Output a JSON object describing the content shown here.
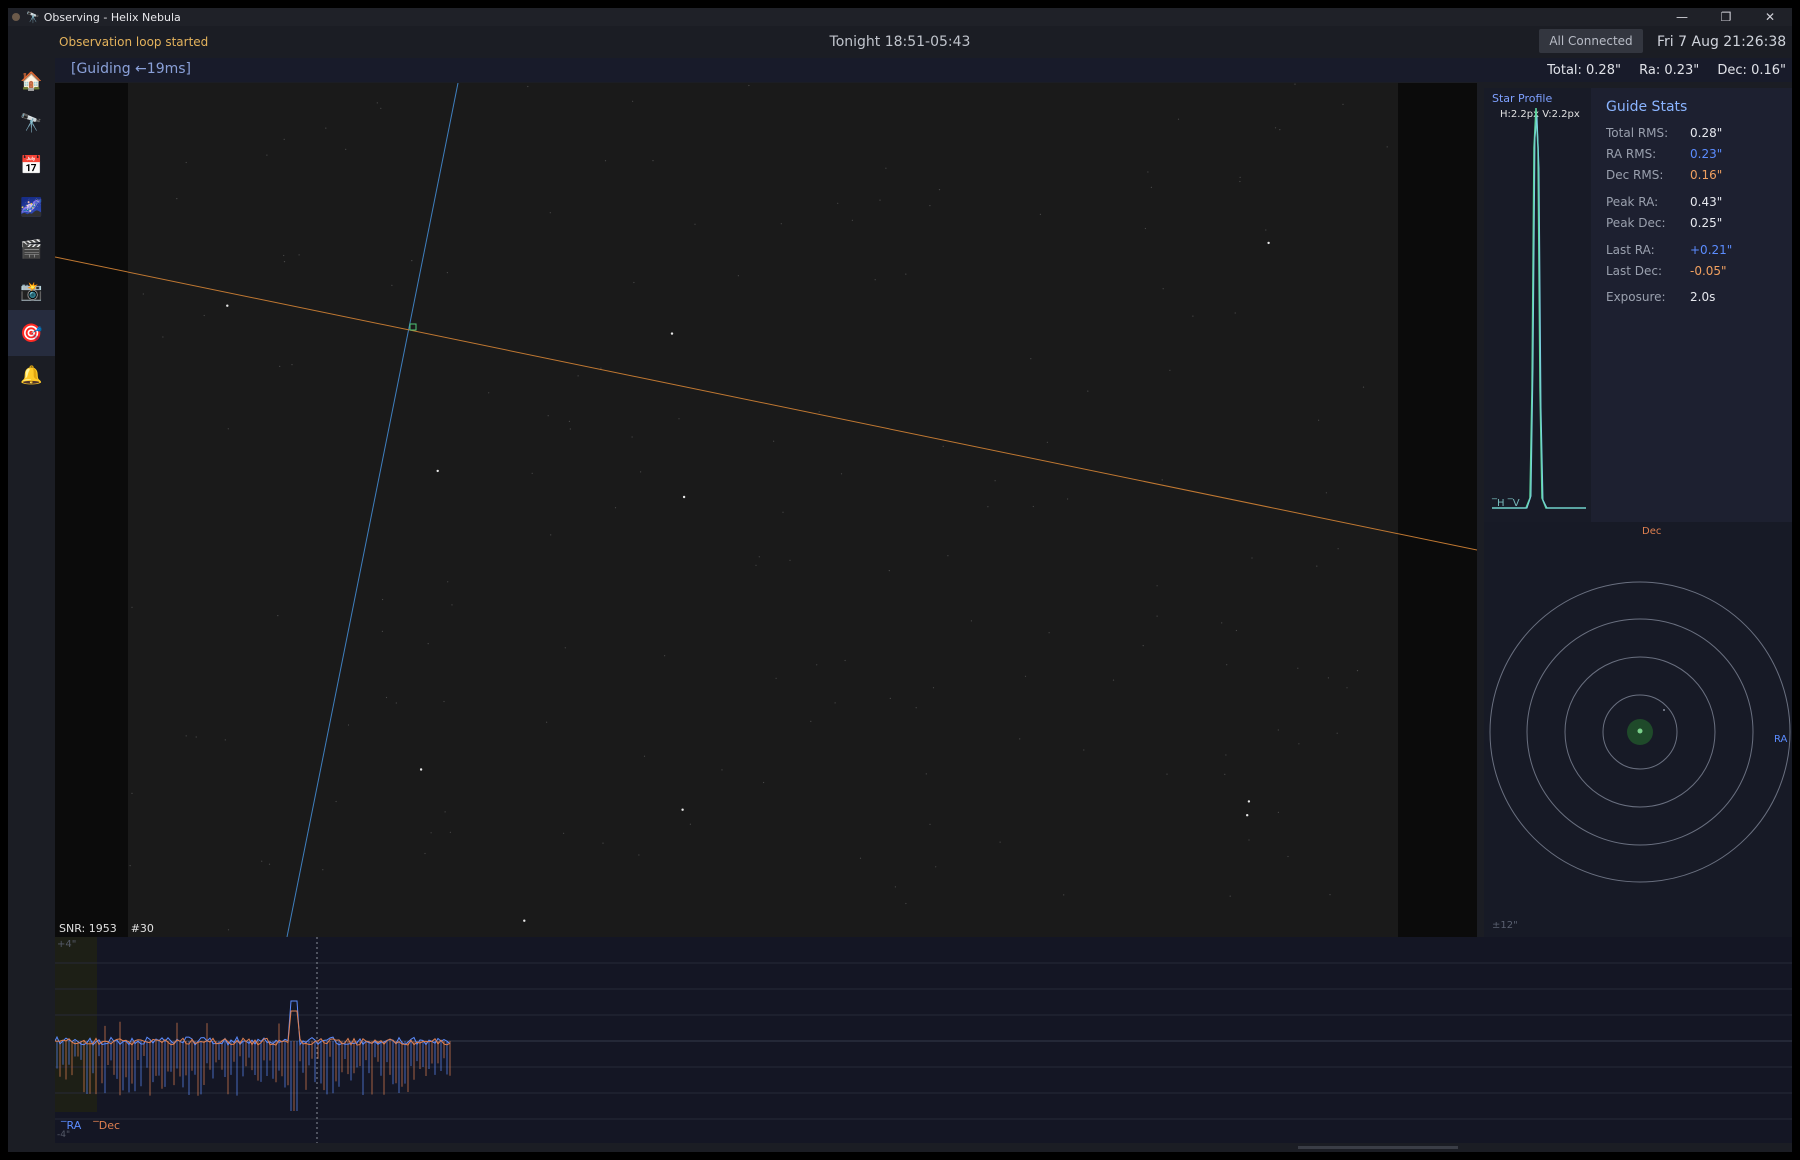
{
  "window": {
    "title": "Observing - Helix Nebula",
    "controls": {
      "minimize": "—",
      "maximize": "❐",
      "close": "✕"
    }
  },
  "status": {
    "message": "Observation loop started",
    "tonight": "Tonight  18:51-05:43",
    "connection": "All Connected",
    "datetime": "Fri 7 Aug 21:26:38"
  },
  "sidebar": {
    "items": [
      {
        "name": "home",
        "icon": "🏠"
      },
      {
        "name": "telescope",
        "icon": "🔭"
      },
      {
        "name": "calendar",
        "icon": "📅"
      },
      {
        "name": "galaxy",
        "icon": "🌌"
      },
      {
        "name": "sequence",
        "icon": "🎬"
      },
      {
        "name": "camera",
        "icon": "📸"
      },
      {
        "name": "guiding",
        "icon": "🎯",
        "active": true
      },
      {
        "name": "alerts",
        "icon": "🔔"
      }
    ]
  },
  "guiding": {
    "label": "[Guiding ←19ms]",
    "total": "Total: 0.28\"",
    "ra": "Ra: 0.23\"",
    "dec": "Dec: 0.16\""
  },
  "camera": {
    "snr": "SNR: 1953",
    "frame": "#30"
  },
  "profile": {
    "title": "Star Profile",
    "sizes": "H:2.2px  V:2.2px",
    "legend": "‾H ‾V"
  },
  "stats": {
    "title": "Guide Stats",
    "rows": [
      {
        "label": "Total RMS:",
        "value": "0.28\"",
        "color": "#e6e8ee"
      },
      {
        "label": "RA RMS:",
        "value": "0.23\"",
        "color": "#5b8cff"
      },
      {
        "label": "Dec RMS:",
        "value": "0.16\"",
        "color": "#f0a060"
      },
      {
        "label": "Peak RA:",
        "value": "0.43\"",
        "color": "#e6e8ee"
      },
      {
        "label": "Peak Dec:",
        "value": "0.25\"",
        "color": "#e6e8ee"
      },
      {
        "label": "Last RA:",
        "value": "+0.21\"",
        "color": "#5b8cff"
      },
      {
        "label": "Last Dec:",
        "value": "-0.05\"",
        "color": "#f0a060"
      },
      {
        "label": "Exposure:",
        "value": "2.0s",
        "color": "#e6e8ee"
      }
    ]
  },
  "target": {
    "dec_label": "Dec",
    "ra_label": "RA",
    "scale": "±12\""
  },
  "graph": {
    "y_top": "+4\"",
    "y_bottom": "-4\"",
    "legend_ra": "‾RA",
    "legend_dec": "‾Dec",
    "ra_color": "#5b8cff",
    "dec_color": "#e08050"
  },
  "colors": {
    "accent": "#8ab4ff",
    "ra": "#5b8cff",
    "dec": "#e08050",
    "status": "#e3b25c",
    "profile": "#5fd6a0"
  }
}
